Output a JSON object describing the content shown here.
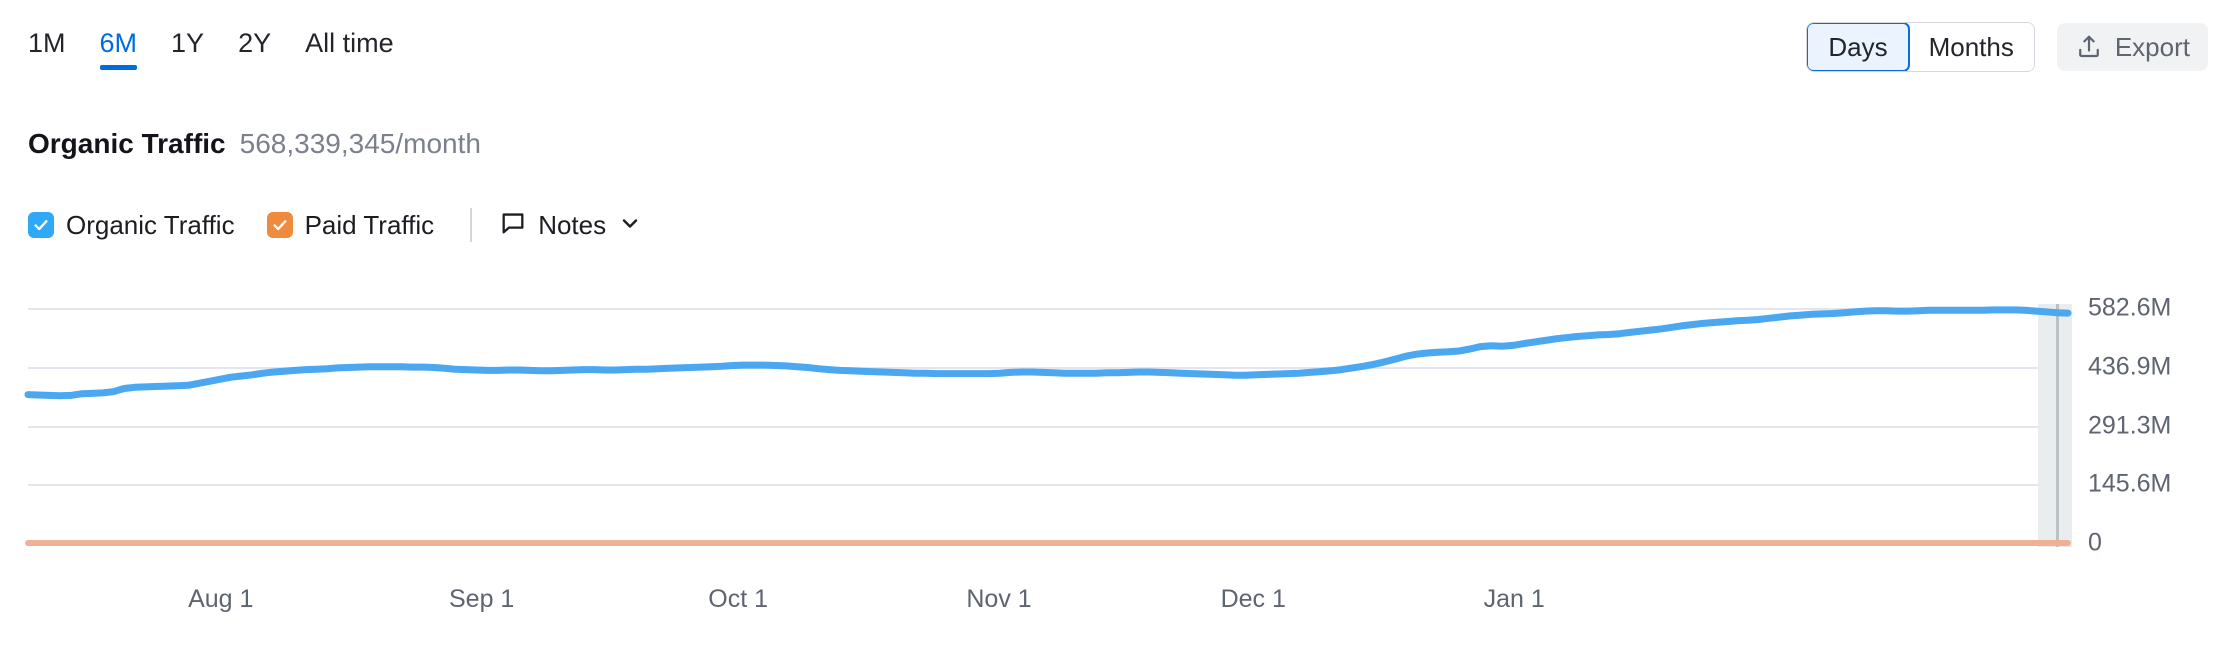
{
  "toolbar": {
    "ranges": [
      {
        "label": "1M",
        "active": false
      },
      {
        "label": "6M",
        "active": true
      },
      {
        "label": "1Y",
        "active": false
      },
      {
        "label": "2Y",
        "active": false
      },
      {
        "label": "All time",
        "active": false
      }
    ],
    "granularity": [
      {
        "label": "Days",
        "active": true
      },
      {
        "label": "Months",
        "active": false
      }
    ],
    "export_label": "Export",
    "export_icon": "upload-icon",
    "accent_color": "#006ce0"
  },
  "header": {
    "title": "Organic Traffic",
    "value": "568,339,345/month"
  },
  "legend": {
    "items": [
      {
        "label": "Organic Traffic",
        "color": "#2fa8f5",
        "checked": true
      },
      {
        "label": "Paid Traffic",
        "color": "#f08a3c",
        "checked": true
      }
    ],
    "notes_label": "Notes",
    "notes_icon": "note-bubble-icon",
    "notes_chevron_icon": "chevron-down-icon"
  },
  "chart_data": {
    "type": "line",
    "title": "Organic Traffic",
    "xlabel": "",
    "ylabel": "",
    "grid": true,
    "legend_position": "top-left",
    "ylim": [
      0,
      582600000
    ],
    "ytick_labels": [
      "582.6M",
      "436.9M",
      "291.3M",
      "145.6M",
      "0"
    ],
    "ytick_values": [
      582600000,
      436900000,
      291300000,
      145600000,
      0
    ],
    "xtick_labels": [
      "Aug 1",
      "Sep 1",
      "Oct 1",
      "Nov 1",
      "Dec 1",
      "Jan 1"
    ],
    "xtick_positions": [
      0.099,
      0.216,
      0.331,
      0.448,
      0.562,
      0.679
    ],
    "series": [
      {
        "name": "Organic Traffic",
        "color": "#4aa7f0",
        "values": [
          368000000,
          367000000,
          366000000,
          365000000,
          366000000,
          370000000,
          371000000,
          372000000,
          375000000,
          383000000,
          386000000,
          387000000,
          388000000,
          389000000,
          390000000,
          391000000,
          396000000,
          401000000,
          406000000,
          411000000,
          414000000,
          417000000,
          421000000,
          424000000,
          426000000,
          428000000,
          430000000,
          431000000,
          432000000,
          434000000,
          435000000,
          436000000,
          437000000,
          437000000,
          437000000,
          437000000,
          436000000,
          436000000,
          435000000,
          433000000,
          431000000,
          430000000,
          429000000,
          428000000,
          428000000,
          429000000,
          429000000,
          428000000,
          427000000,
          427000000,
          428000000,
          429000000,
          430000000,
          430000000,
          429000000,
          429000000,
          430000000,
          431000000,
          431000000,
          432000000,
          433000000,
          434000000,
          435000000,
          436000000,
          437000000,
          438000000,
          440000000,
          441000000,
          441000000,
          441000000,
          440000000,
          439000000,
          437000000,
          435000000,
          432000000,
          430000000,
          428000000,
          427000000,
          426000000,
          425000000,
          424000000,
          423000000,
          422000000,
          421000000,
          421000000,
          420000000,
          420000000,
          420000000,
          420000000,
          420000000,
          420000000,
          421000000,
          423000000,
          424000000,
          424000000,
          423000000,
          422000000,
          421000000,
          421000000,
          421000000,
          421000000,
          422000000,
          422000000,
          423000000,
          424000000,
          424000000,
          423000000,
          422000000,
          421000000,
          420000000,
          419000000,
          418000000,
          417000000,
          416000000,
          416000000,
          417000000,
          418000000,
          419000000,
          420000000,
          421000000,
          423000000,
          425000000,
          427000000,
          430000000,
          434000000,
          438000000,
          443000000,
          449000000,
          456000000,
          463000000,
          468000000,
          471000000,
          473000000,
          474000000,
          476000000,
          481000000,
          487000000,
          489000000,
          488000000,
          490000000,
          494000000,
          498000000,
          502000000,
          506000000,
          509000000,
          512000000,
          514000000,
          516000000,
          517000000,
          519000000,
          522000000,
          525000000,
          528000000,
          531000000,
          535000000,
          539000000,
          542000000,
          545000000,
          547000000,
          549000000,
          551000000,
          552000000,
          554000000,
          557000000,
          560000000,
          563000000,
          565000000,
          567000000,
          568000000,
          569000000,
          571000000,
          573000000,
          575000000,
          576000000,
          576000000,
          575000000,
          575000000,
          576000000,
          577000000,
          577000000,
          577000000,
          577000000,
          577000000,
          577000000,
          578000000,
          578000000,
          578000000,
          577000000,
          575000000,
          573000000,
          571000000,
          570000000
        ]
      },
      {
        "name": "Paid Traffic",
        "color": "#efb193",
        "values": [
          0,
          0,
          0,
          0,
          0,
          0,
          0,
          0,
          0,
          0,
          0,
          0,
          0,
          0,
          0,
          0,
          0,
          0,
          0,
          0,
          0,
          0,
          0,
          0,
          0,
          0,
          0,
          0,
          0,
          0,
          0,
          0,
          0,
          0,
          0,
          0,
          0,
          0,
          0,
          0,
          0,
          0,
          0,
          0,
          0,
          0,
          0,
          0,
          0,
          0,
          0,
          0,
          0,
          0,
          0,
          0,
          0,
          0,
          0,
          0,
          0,
          0,
          0,
          0,
          0,
          0,
          0,
          0,
          0,
          0,
          0,
          0,
          0,
          0,
          0,
          0,
          0,
          0,
          0,
          0,
          0,
          0,
          0,
          0,
          0,
          0,
          0,
          0,
          0,
          0,
          0,
          0,
          0,
          0,
          0,
          0,
          0,
          0,
          0,
          0,
          0,
          0,
          0,
          0,
          0,
          0,
          0,
          0,
          0,
          0,
          0,
          0,
          0,
          0,
          0,
          0,
          0,
          0,
          0,
          0,
          0,
          0,
          0,
          0,
          0,
          0,
          0,
          0,
          0,
          0,
          0,
          0,
          0,
          0,
          0,
          0,
          0,
          0,
          0,
          0,
          0,
          0,
          0,
          0,
          0,
          0,
          0,
          0,
          0,
          0,
          0,
          0,
          0,
          0,
          0,
          0,
          0,
          0,
          0,
          0,
          0,
          0,
          0,
          0,
          0,
          0,
          0,
          0,
          0,
          0,
          0,
          0,
          0,
          0,
          0,
          0,
          0,
          0,
          0,
          0,
          0,
          0,
          0,
          0,
          0,
          0,
          0,
          0,
          0,
          0,
          0,
          0
        ]
      }
    ],
    "highlight_band": {
      "start": 0.9853,
      "end": 0.995
    }
  }
}
